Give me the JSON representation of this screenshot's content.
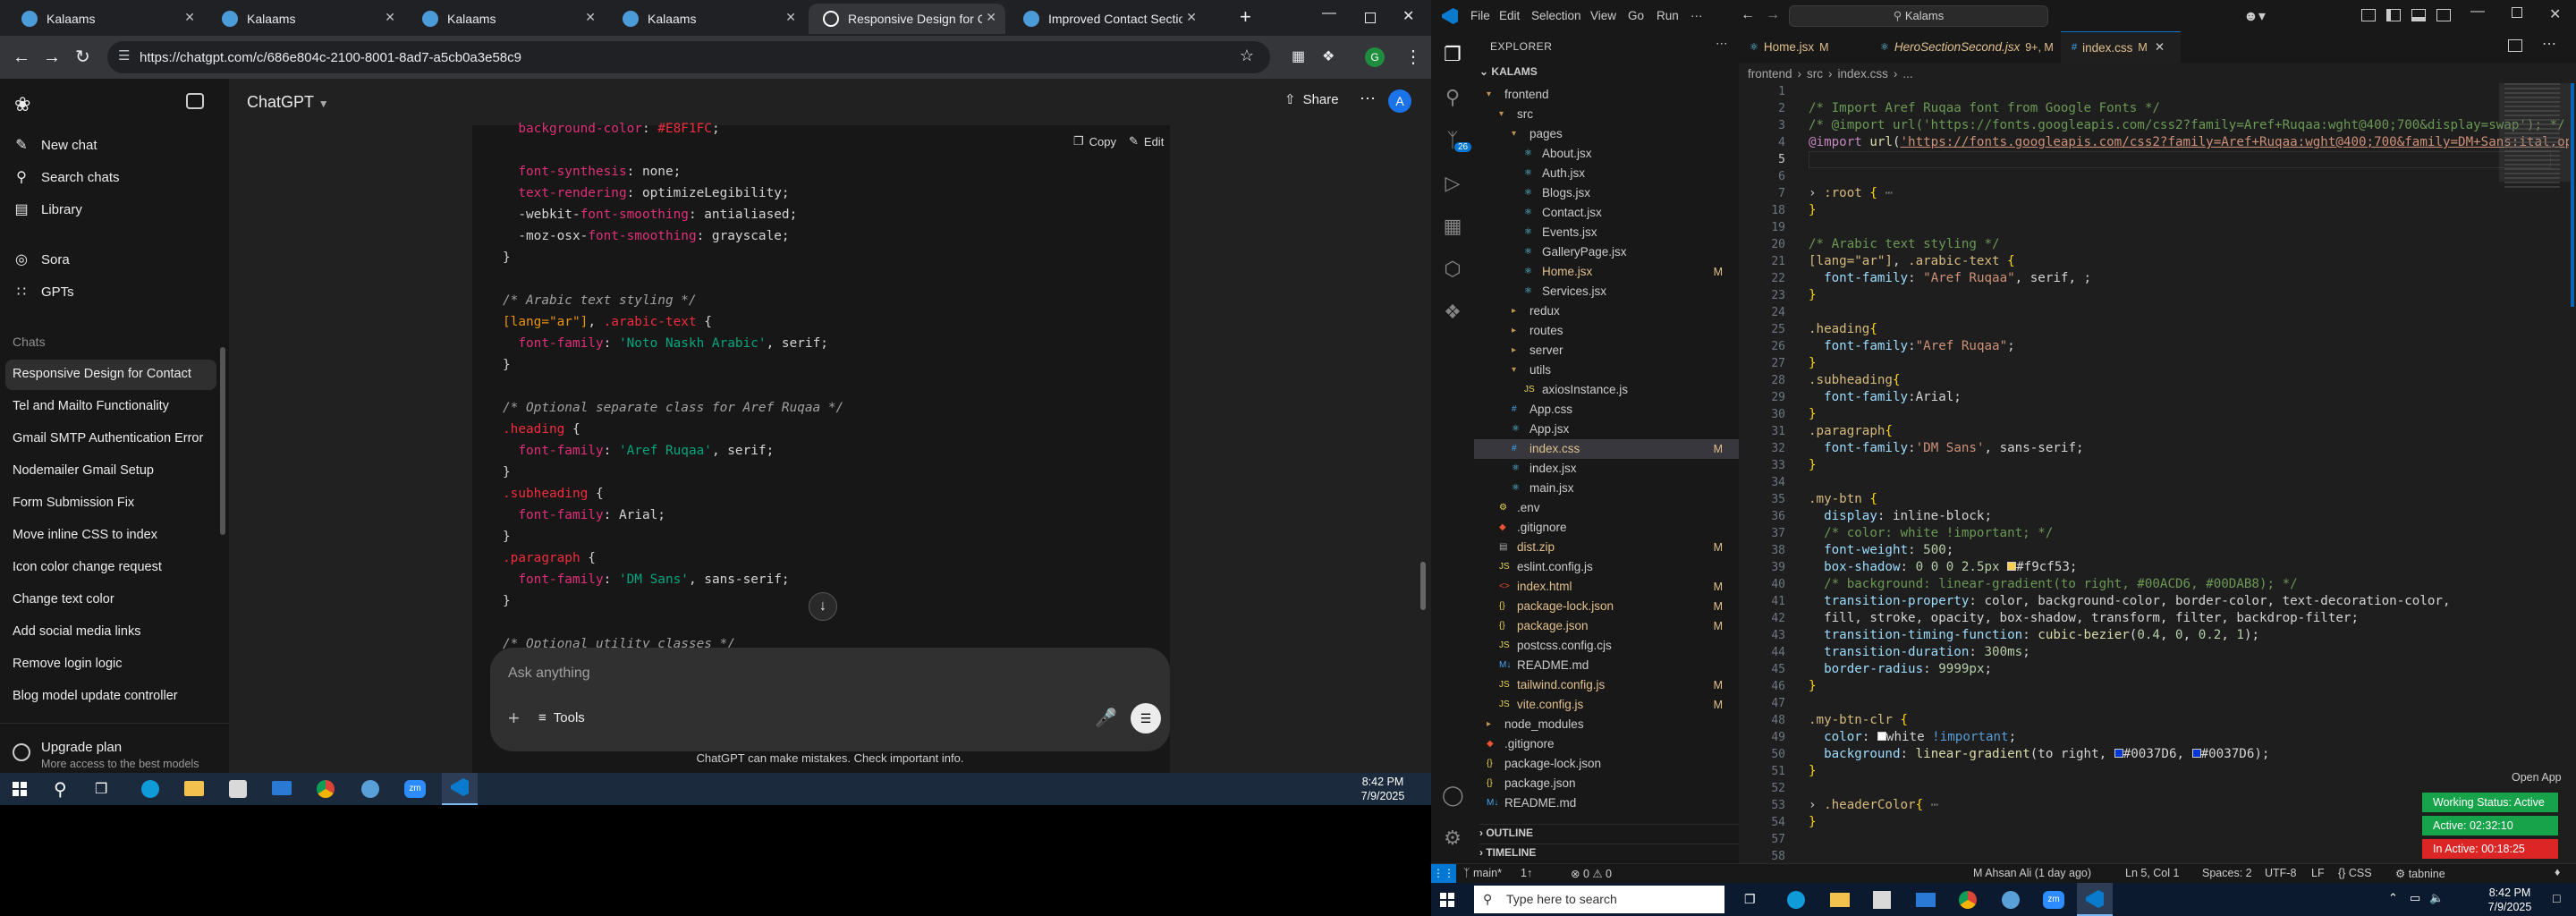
{
  "chrome": {
    "tabs": [
      {
        "title": "Kalaams",
        "active": false
      },
      {
        "title": "Kalaams",
        "active": false
      },
      {
        "title": "Kalaams",
        "active": false
      },
      {
        "title": "Kalaams",
        "active": false
      },
      {
        "title": "Responsive Design for Conta",
        "active": true
      },
      {
        "title": "Improved Contact Section St",
        "active": false
      }
    ],
    "url": "https://chatgpt.com/c/686e804c-2100-8001-8ad7-a5cb0a3e58c9"
  },
  "chatgpt": {
    "model": "ChatGPT",
    "nav": [
      {
        "label": "New chat",
        "icon": "edit-icon"
      },
      {
        "label": "Search chats",
        "icon": "search-icon"
      },
      {
        "label": "Library",
        "icon": "library-icon"
      },
      {
        "label": "Sora",
        "icon": "sora-icon"
      },
      {
        "label": "GPTs",
        "icon": "gpts-icon"
      }
    ],
    "chats_heading": "Chats",
    "chats": [
      "Responsive Design for Contact",
      "Tel and Mailto Functionality",
      "Gmail SMTP Authentication Error",
      "Nodemailer Gmail Setup",
      "Form Submission Fix",
      "Move inline CSS to index",
      "Icon color change request",
      "Change text color",
      "Add social media links",
      "Remove login logic",
      "Blog model update controller"
    ],
    "upgrade_title": "Upgrade plan",
    "upgrade_sub": "More access to the best models",
    "share": "Share",
    "avatar_letter": "A",
    "copy": "Copy",
    "edit": "Edit",
    "input_placeholder": "Ask anything",
    "tools": "Tools",
    "disclaimer": "ChatGPT can make mistakes. Check important info."
  },
  "win_left": {
    "time": "8:42 PM",
    "date": "7/9/2025"
  },
  "vscode": {
    "menu": [
      "File",
      "Edit",
      "Selection",
      "View",
      "Go",
      "Run",
      "···"
    ],
    "search": "Kalams",
    "explorer_title": "EXPLORER",
    "project": "KALAMS",
    "tree": [
      {
        "label": "frontend",
        "indent": 1,
        "kind": "folder-open",
        "badge": ""
      },
      {
        "label": "src",
        "indent": 2,
        "kind": "folder-open",
        "badge": ""
      },
      {
        "label": "pages",
        "indent": 3,
        "kind": "folder-open",
        "badge": ""
      },
      {
        "label": "About.jsx",
        "indent": 4,
        "kind": "jsx",
        "badge": ""
      },
      {
        "label": "Auth.jsx",
        "indent": 4,
        "kind": "jsx",
        "badge": ""
      },
      {
        "label": "Blogs.jsx",
        "indent": 4,
        "kind": "jsx",
        "badge": ""
      },
      {
        "label": "Contact.jsx",
        "indent": 4,
        "kind": "jsx",
        "badge": ""
      },
      {
        "label": "Events.jsx",
        "indent": 4,
        "kind": "jsx",
        "badge": ""
      },
      {
        "label": "GalleryPage.jsx",
        "indent": 4,
        "kind": "jsx",
        "badge": ""
      },
      {
        "label": "Home.jsx",
        "indent": 4,
        "kind": "jsx",
        "badge": "M"
      },
      {
        "label": "Services.jsx",
        "indent": 4,
        "kind": "jsx",
        "badge": ""
      },
      {
        "label": "redux",
        "indent": 3,
        "kind": "folder",
        "badge": ""
      },
      {
        "label": "routes",
        "indent": 3,
        "kind": "folder",
        "badge": ""
      },
      {
        "label": "server",
        "indent": 3,
        "kind": "folder",
        "badge": ""
      },
      {
        "label": "utils",
        "indent": 3,
        "kind": "folder-open",
        "badge": ""
      },
      {
        "label": "axiosInstance.js",
        "indent": 4,
        "kind": "js",
        "badge": ""
      },
      {
        "label": "App.css",
        "indent": 3,
        "kind": "css",
        "badge": ""
      },
      {
        "label": "App.jsx",
        "indent": 3,
        "kind": "jsx",
        "badge": ""
      },
      {
        "label": "index.css",
        "indent": 3,
        "kind": "css",
        "badge": "M",
        "selected": true
      },
      {
        "label": "index.jsx",
        "indent": 3,
        "kind": "jsx",
        "badge": ""
      },
      {
        "label": "main.jsx",
        "indent": 3,
        "kind": "jsx",
        "badge": ""
      },
      {
        "label": ".env",
        "indent": 2,
        "kind": "env",
        "badge": ""
      },
      {
        "label": ".gitignore",
        "indent": 2,
        "kind": "git",
        "badge": ""
      },
      {
        "label": "dist.zip",
        "indent": 2,
        "kind": "zip",
        "badge": "M"
      },
      {
        "label": "eslint.config.js",
        "indent": 2,
        "kind": "js",
        "badge": ""
      },
      {
        "label": "index.html",
        "indent": 2,
        "kind": "html",
        "badge": "M"
      },
      {
        "label": "package-lock.json",
        "indent": 2,
        "kind": "json",
        "badge": "M"
      },
      {
        "label": "package.json",
        "indent": 2,
        "kind": "json",
        "badge": "M"
      },
      {
        "label": "postcss.config.cjs",
        "indent": 2,
        "kind": "js",
        "badge": ""
      },
      {
        "label": "README.md",
        "indent": 2,
        "kind": "md",
        "badge": ""
      },
      {
        "label": "tailwind.config.js",
        "indent": 2,
        "kind": "js",
        "badge": "M"
      },
      {
        "label": "vite.config.js",
        "indent": 2,
        "kind": "js",
        "badge": "M"
      },
      {
        "label": "node_modules",
        "indent": 1,
        "kind": "folder",
        "badge": ""
      },
      {
        "label": ".gitignore",
        "indent": 1,
        "kind": "git",
        "badge": ""
      },
      {
        "label": "package-lock.json",
        "indent": 1,
        "kind": "json",
        "badge": ""
      },
      {
        "label": "package.json",
        "indent": 1,
        "kind": "json",
        "badge": ""
      },
      {
        "label": "README.md",
        "indent": 1,
        "kind": "md",
        "badge": ""
      }
    ],
    "outline": "OUTLINE",
    "timeline": "TIMELINE",
    "editor_tabs": [
      {
        "label": "Home.jsx",
        "suffix": "M"
      },
      {
        "label": "HeroSectionSecond.jsx",
        "suffix": "9+, M"
      },
      {
        "label": "index.css",
        "suffix": "M",
        "active": true
      }
    ],
    "breadcrumb": [
      "frontend",
      "src",
      "index.css",
      "..."
    ],
    "open_app": "Open App",
    "status": {
      "branch": "main*",
      "sync": "1↑",
      "problems": "⊗ 0 ⚠ 0",
      "blame": "M Ahsan Ali (1 day ago)",
      "cursor": "Ln 5, Col 1",
      "spaces": "Spaces: 2",
      "encoding": "UTF-8",
      "eol": "LF",
      "lang": "CSS",
      "tabnine": "tabnine"
    },
    "pills": [
      {
        "label": "Working Status: Active",
        "color": "#16a34a"
      },
      {
        "label": "Active: 02:32:10",
        "color": "#16a34a"
      },
      {
        "label": "In Active: 00:18:25",
        "color": "#dc2626"
      }
    ]
  },
  "win_right": {
    "search": "Type here to search",
    "time": "8:42 PM",
    "date": "7/9/2025"
  }
}
